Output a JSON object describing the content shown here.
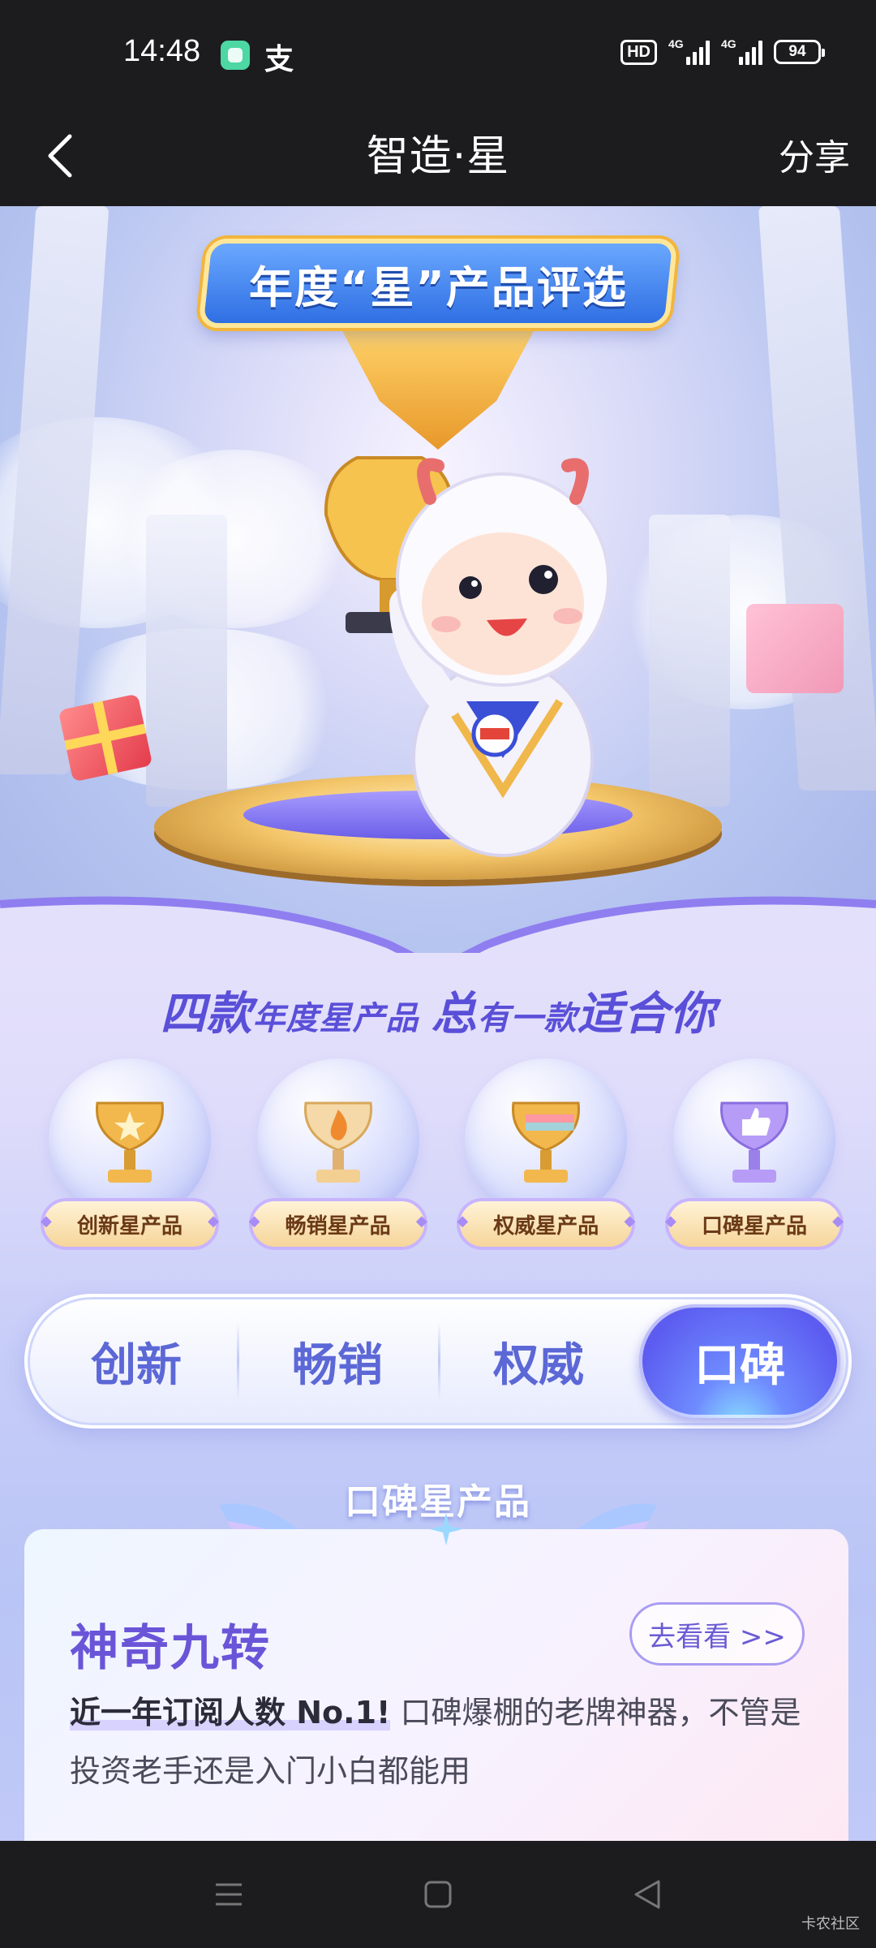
{
  "status_bar": {
    "time": "14:48",
    "hd": "HD",
    "signal1": "4G",
    "signal2": "4G",
    "battery": "94"
  },
  "nav": {
    "title": "智造·星",
    "share": "分享"
  },
  "hero": {
    "banner": "年度“星”产品评选"
  },
  "slogan": {
    "part1": "四款",
    "part2": "年度星",
    "part3": "产品 ",
    "part4": "总",
    "part5": "有一款",
    "part6": "适合你"
  },
  "trophies": [
    {
      "label": "创新星产品",
      "icon": "star-trophy-icon",
      "color": "#f0b44a"
    },
    {
      "label": "畅销星产品",
      "icon": "flame-trophy-icon",
      "color": "#f0b44a"
    },
    {
      "label": "权威星产品",
      "icon": "gem-trophy-icon",
      "color": "#f0b44a"
    },
    {
      "label": "口碑星产品",
      "icon": "thumbs-up-trophy-icon",
      "color": "#a98cf5"
    }
  ],
  "tabs": [
    {
      "label": "创新",
      "active": false
    },
    {
      "label": "畅销",
      "active": false
    },
    {
      "label": "权威",
      "active": false
    },
    {
      "label": "口碑",
      "active": true
    }
  ],
  "section": {
    "title": "口碑星产品"
  },
  "product": {
    "name": "神奇九转",
    "button": "去看看 >>",
    "highlight": "近一年订阅人数 No.1!",
    "desc": " 口碑爆棚的老牌神器，不管是投资老手还是入门小白都能用"
  },
  "watermark": "卡农社区",
  "colors": {
    "accent": "#5c5cf0",
    "brand_purple": "#6a55d8",
    "gold": "#f0b44a"
  }
}
